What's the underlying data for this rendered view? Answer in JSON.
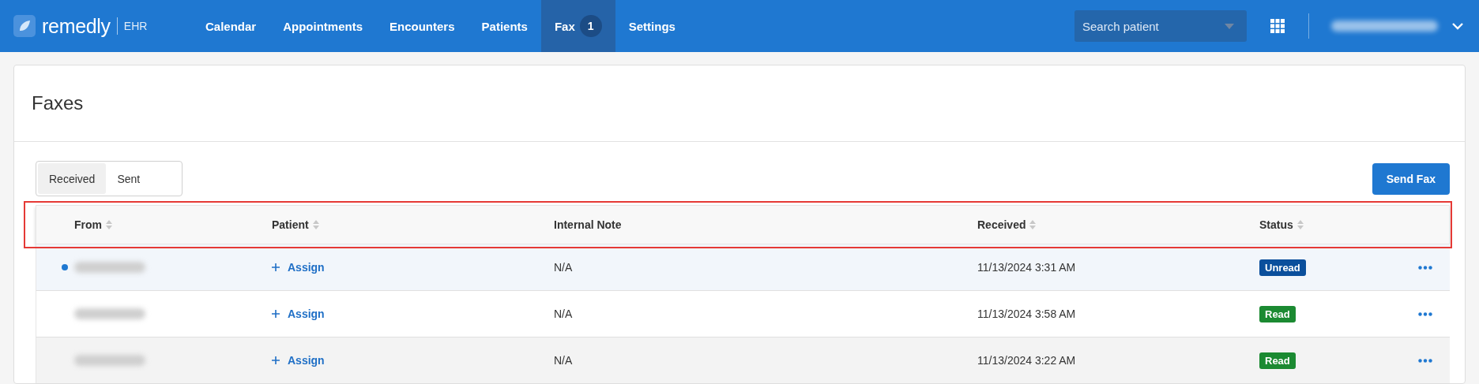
{
  "brand": {
    "name": "remedly",
    "product": "EHR"
  },
  "nav": [
    {
      "label": "Calendar",
      "selected": false
    },
    {
      "label": "Appointments",
      "selected": false
    },
    {
      "label": "Encounters",
      "selected": false
    },
    {
      "label": "Patients",
      "selected": false
    },
    {
      "label": "Fax",
      "selected": true,
      "badge": "1"
    },
    {
      "label": "Settings",
      "selected": false
    }
  ],
  "search": {
    "placeholder": "Search patient"
  },
  "page_title": "Faxes",
  "tabs": [
    {
      "label": "Received",
      "selected": true
    },
    {
      "label": "Sent",
      "selected": false
    }
  ],
  "send_button": "Send Fax",
  "table": {
    "columns": [
      {
        "label": "From",
        "sortable": true
      },
      {
        "label": "Patient",
        "sortable": true
      },
      {
        "label": "Internal Note",
        "sortable": false
      },
      {
        "label": "Received",
        "sortable": true
      },
      {
        "label": "Status",
        "sortable": true
      }
    ],
    "rows": [
      {
        "unread": true,
        "hovered": false,
        "assign": "Assign",
        "note": "N/A",
        "received": "11/13/2024 3:31 AM",
        "status": {
          "label": "Unread",
          "kind": "unread"
        }
      },
      {
        "unread": false,
        "hovered": false,
        "assign": "Assign",
        "note": "N/A",
        "received": "11/13/2024 3:58 AM",
        "status": {
          "label": "Read",
          "kind": "read"
        }
      },
      {
        "unread": false,
        "hovered": true,
        "assign": "Assign",
        "note": "N/A",
        "received": "11/13/2024 3:22 AM",
        "status": {
          "label": "Read",
          "kind": "read"
        }
      }
    ]
  }
}
